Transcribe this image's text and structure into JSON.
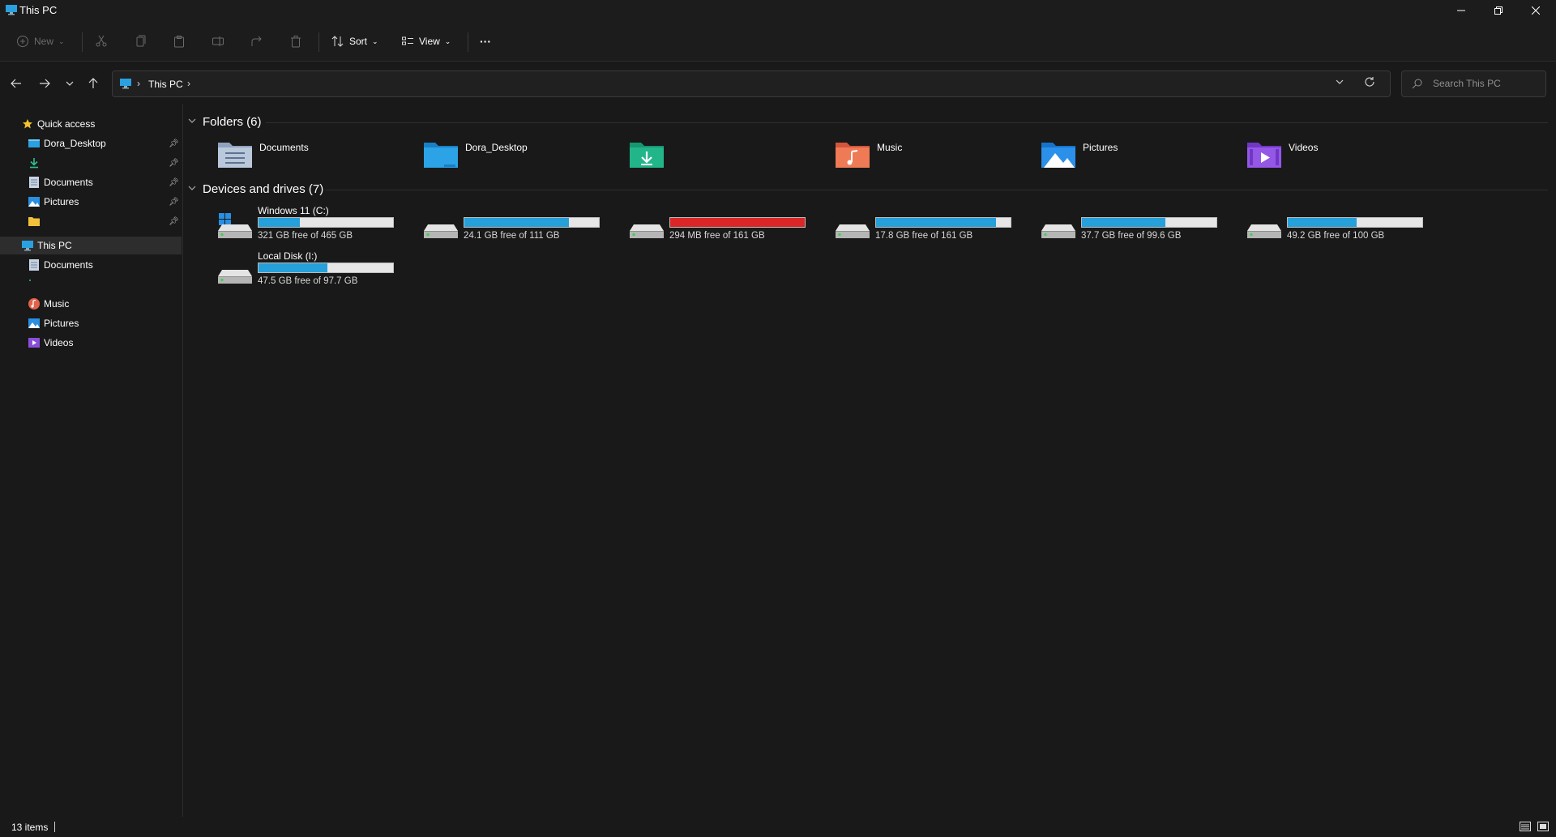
{
  "window": {
    "title": "This PC"
  },
  "toolbar": {
    "new_label": "New",
    "sort_label": "Sort",
    "view_label": "View",
    "more_label": "···"
  },
  "address": {
    "path": [
      "This PC"
    ],
    "search_placeholder": "Search This PC"
  },
  "sidebar": {
    "quick_access_label": "Quick access",
    "pinned": [
      {
        "label": "Dora_Desktop",
        "icon": "desktop-icon"
      },
      {
        "label": "",
        "icon": "downloads-icon"
      },
      {
        "label": "Documents",
        "icon": "documents-icon"
      },
      {
        "label": "Pictures",
        "icon": "pictures-icon"
      },
      {
        "label": "",
        "icon": "folder-icon"
      }
    ],
    "this_pc_label": "This PC",
    "this_pc_children": [
      {
        "label": "Documents",
        "icon": "documents-icon"
      },
      {
        "label": "",
        "icon": "downloads-icon"
      },
      {
        "label": "Music",
        "icon": "music-icon"
      },
      {
        "label": "Pictures",
        "icon": "pictures-icon"
      },
      {
        "label": "Videos",
        "icon": "videos-icon"
      }
    ]
  },
  "folders": {
    "heading": "Folders (6)",
    "items": [
      {
        "label": "Documents",
        "icon": "documents-folder-icon"
      },
      {
        "label": "Dora_Desktop",
        "icon": "desktop-folder-icon"
      },
      {
        "label": "",
        "icon": "downloads-folder-icon"
      },
      {
        "label": "Music",
        "icon": "music-folder-icon"
      },
      {
        "label": "Pictures",
        "icon": "pictures-folder-icon"
      },
      {
        "label": "Videos",
        "icon": "videos-folder-icon"
      }
    ]
  },
  "drives": {
    "heading": "Devices and drives (7)",
    "items": [
      {
        "name": "Windows 11 (C:)",
        "free": "321 GB free of 465 GB",
        "used_fraction": 0.31,
        "icon": "windows-drive-icon"
      },
      {
        "name": "",
        "free": "24.1 GB free of 111 GB",
        "used_fraction": 0.78,
        "icon": "drive-icon"
      },
      {
        "name": "",
        "free": "294 MB free of 161 GB",
        "used_fraction": 1.0,
        "icon": "drive-icon"
      },
      {
        "name": "",
        "free": "17.8 GB free of 161 GB",
        "used_fraction": 0.89,
        "icon": "drive-icon"
      },
      {
        "name": "",
        "free": "37.7 GB free of 99.6 GB",
        "used_fraction": 0.62,
        "icon": "drive-icon"
      },
      {
        "name": "",
        "free": "49.2 GB free of 100 GB",
        "used_fraction": 0.51,
        "icon": "drive-icon"
      },
      {
        "name": "Local Disk (I:)",
        "free": "47.5 GB free of 97.7 GB",
        "used_fraction": 0.51,
        "icon": "drive-icon"
      }
    ]
  },
  "status": {
    "items_count": "13 items"
  },
  "colors": {
    "accent": "#26a0da",
    "full_drive": "#da2626",
    "background": "#191919"
  }
}
